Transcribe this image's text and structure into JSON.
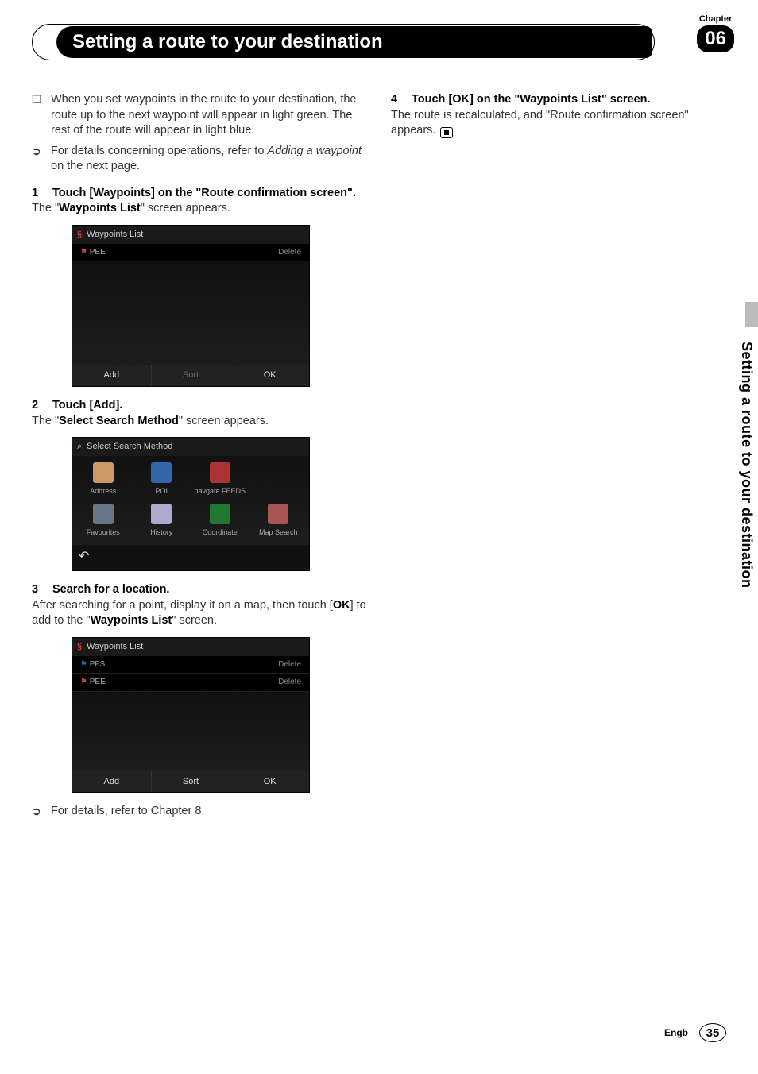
{
  "chapter_label": "Chapter",
  "chapter_number": "06",
  "page_title": "Setting a route to your destination",
  "side_tab_text": "Setting a route to your destination",
  "left": {
    "bullet1": "When you set waypoints in the route to your destination, the route up to the next waypoint will appear in light green. The rest of the route will appear in light blue.",
    "bullet2a": "For details concerning operations, refer to ",
    "bullet2b_italic": "Adding a waypoint",
    "bullet2c": " on the next page.",
    "step1_head": "Touch [Waypoints] on the \"Route confirmation screen\".",
    "step1_body_pre": "The \"",
    "step1_body_bold": "Waypoints List",
    "step1_body_post": "\" screen appears.",
    "ss1": {
      "title": "Waypoints List",
      "row1_label": "PEE",
      "row1_action": "Delete",
      "btn_add": "Add",
      "btn_sort": "Sort",
      "btn_ok": "OK"
    },
    "step2_head": "Touch [Add].",
    "step2_body_pre": "The \"",
    "step2_body_bold": "Select Search Method",
    "step2_body_post": "\" screen appears.",
    "ssm": {
      "title": "Select Search Method",
      "c1": "Address",
      "c2": "POI",
      "c3": "navgate FEEDS",
      "c5": "Favourites",
      "c6": "History",
      "c7": "Coordinate",
      "c8": "Map Search",
      "back": "↶"
    },
    "step3_head": "Search for a location.",
    "step3_body_a": "After searching for a point, display it on a map, then touch [",
    "step3_body_b_bold": "OK",
    "step3_body_c": "] to add to the \"",
    "step3_body_d_bold": "Waypoints List",
    "step3_body_e": "\" screen.",
    "ss3": {
      "title": "Waypoints List",
      "row1_label": "PFS",
      "row1_action": "Delete",
      "row2_label": "PEE",
      "row2_action": "Delete",
      "btn_add": "Add",
      "btn_sort": "Sort",
      "btn_ok": "OK"
    },
    "bullet3": "For details, refer to Chapter 8."
  },
  "right": {
    "step4_head": "Touch [OK] on the \"Waypoints List\" screen.",
    "step4_body": "The route is recalculated, and \"Route confirmation screen\" appears."
  },
  "footer_lang": "Engb",
  "page_number": "35"
}
